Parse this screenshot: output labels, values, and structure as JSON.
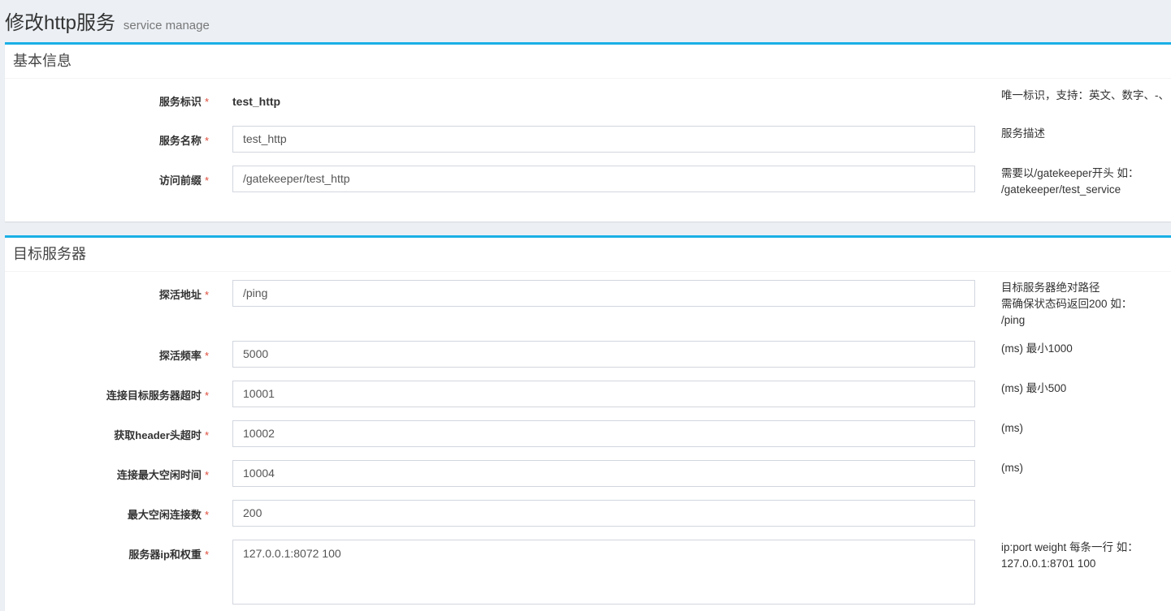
{
  "page": {
    "title": "修改http服务",
    "subtitle": "service manage"
  },
  "basic": {
    "header": "基本信息",
    "service_id_label": "服务标识",
    "service_id_value": "test_http",
    "service_id_help": "唯一标识，支持：英文、数字、-、",
    "service_name_label": "服务名称",
    "service_name_value": "test_http",
    "service_name_help": "服务描述",
    "prefix_label": "访问前缀",
    "prefix_value": "/gatekeeper/test_http",
    "prefix_help_line1": "需要以/gatekeeper开头 如：",
    "prefix_help_line2": "/gatekeeper/test_service"
  },
  "target": {
    "header": "目标服务器",
    "ping_label": "探活地址",
    "ping_value": "/ping",
    "ping_help_line1": "目标服务器绝对路径",
    "ping_help_line2": "需确保状态码返回200 如：",
    "ping_help_line3": "/ping",
    "ping_freq_label": "探活频率",
    "ping_freq_value": "5000",
    "ping_freq_help": "(ms) 最小1000",
    "connect_timeout_label": "连接目标服务器超时",
    "connect_timeout_value": "10001",
    "connect_timeout_help": "(ms) 最小500",
    "header_timeout_label": "获取header头超时",
    "header_timeout_value": "10002",
    "header_timeout_help": "(ms)",
    "idle_time_label": "连接最大空闲时间",
    "idle_time_value": "10004",
    "idle_time_help": "(ms)",
    "max_idle_label": "最大空闲连接数",
    "max_idle_value": "200",
    "servers_label": "服务器ip和权重",
    "servers_value": "127.0.0.1:8072 100",
    "servers_help_line1": "ip:port weight 每条一行 如：",
    "servers_help_line2": "127.0.0.1:8701 100"
  },
  "required_mark": "*"
}
